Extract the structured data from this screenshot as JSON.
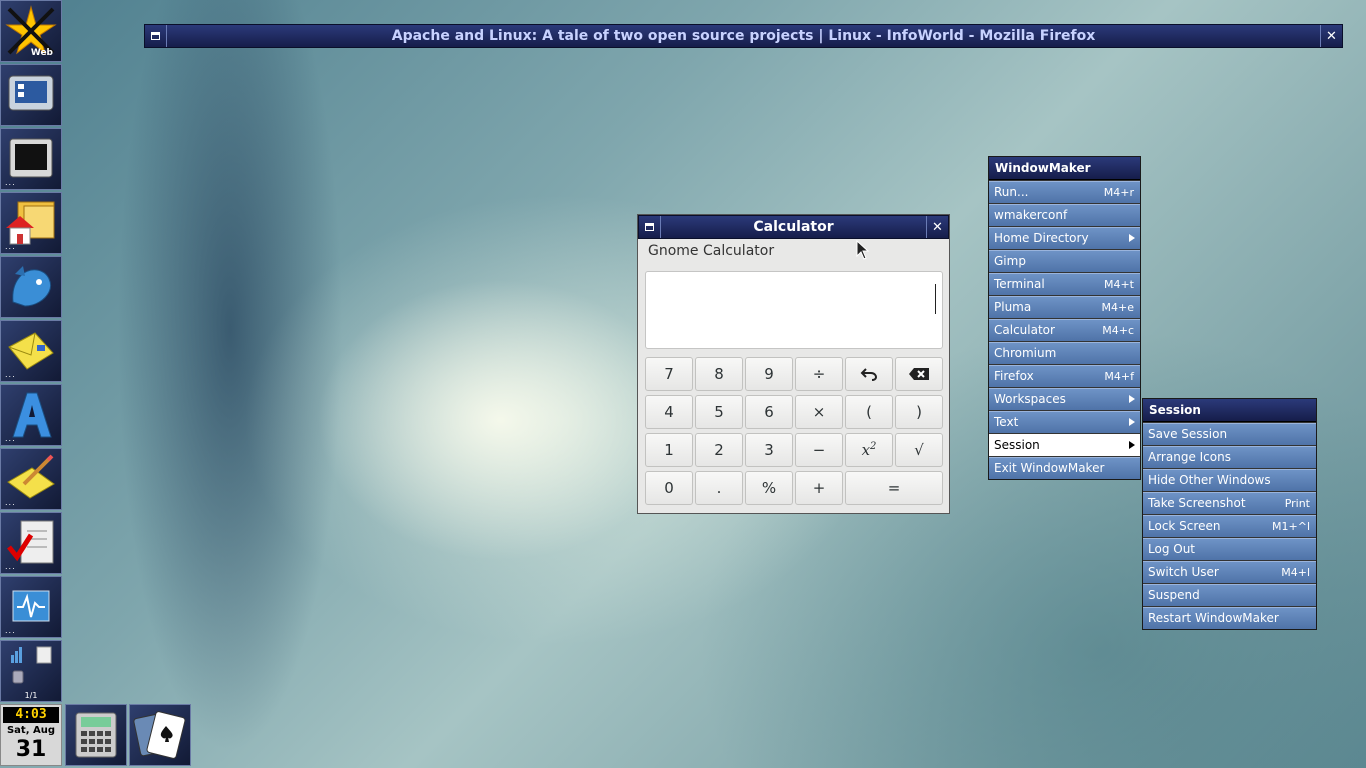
{
  "browser_window": {
    "title": "Apache and Linux: A tale of two open source projects | Linux - InfoWorld - Mozilla Firefox",
    "minimize_icon": "minimize-icon",
    "close_icon": "close-icon"
  },
  "dock": {
    "top_label": "Web",
    "items": [
      "web-star-icon",
      "window-manager-prefs-icon",
      "terminal-monitor-icon",
      "home-folder-icon",
      "dragon-icon",
      "mail-icon",
      "font-a-icon",
      "notepad-pencil-icon",
      "checklist-icon",
      "system-monitor-icon"
    ],
    "pager_label": "1/1"
  },
  "clock": {
    "time": "4:03",
    "date": "Sat, Aug",
    "day": "31"
  },
  "calculator": {
    "title": "Calculator",
    "header": "Gnome Calculator",
    "display_value": "",
    "keys": {
      "k7": "7",
      "k8": "8",
      "k9": "9",
      "div": "÷",
      "k4": "4",
      "k5": "5",
      "k6": "6",
      "mul": "×",
      "lparen": "(",
      "rparen": ")",
      "k1": "1",
      "k2": "2",
      "k3": "3",
      "minus": "−",
      "sqrt": "√",
      "k0": "0",
      "dot": ".",
      "pct": "%",
      "plus": "+",
      "eq": "="
    }
  },
  "wm_menu": {
    "title": "WindowMaker",
    "items": [
      {
        "label": "Run...",
        "shortcut": "M4+r"
      },
      {
        "label": "wmakerconf",
        "shortcut": ""
      },
      {
        "label": "Home Directory",
        "shortcut": ""
      },
      {
        "label": "Gimp",
        "shortcut": ""
      },
      {
        "label": "Terminal",
        "shortcut": "M4+t"
      },
      {
        "label": "Pluma",
        "shortcut": "M4+e"
      },
      {
        "label": "Calculator",
        "shortcut": "M4+c"
      },
      {
        "label": "Chromium",
        "shortcut": ""
      },
      {
        "label": "Firefox",
        "shortcut": "M4+f"
      },
      {
        "label": "Workspaces",
        "shortcut": ""
      },
      {
        "label": "Text",
        "shortcut": ""
      },
      {
        "label": "Session",
        "shortcut": ""
      },
      {
        "label": "Exit WindowMaker",
        "shortcut": ""
      }
    ]
  },
  "session_menu": {
    "title": "Session",
    "items": [
      {
        "label": "Save Session",
        "shortcut": ""
      },
      {
        "label": "Arrange Icons",
        "shortcut": ""
      },
      {
        "label": "Hide Other Windows",
        "shortcut": ""
      },
      {
        "label": "Take Screenshot",
        "shortcut": "Print"
      },
      {
        "label": "Lock Screen",
        "shortcut": "M1+^l"
      },
      {
        "label": "Log Out",
        "shortcut": ""
      },
      {
        "label": "Switch User",
        "shortcut": "M4+l"
      },
      {
        "label": "Suspend",
        "shortcut": ""
      },
      {
        "label": "Restart WindowMaker",
        "shortcut": ""
      }
    ]
  },
  "colors": {
    "titlebar": "#1f2a63",
    "menu_item": "#5f83b8",
    "selected": "#ffffff"
  }
}
